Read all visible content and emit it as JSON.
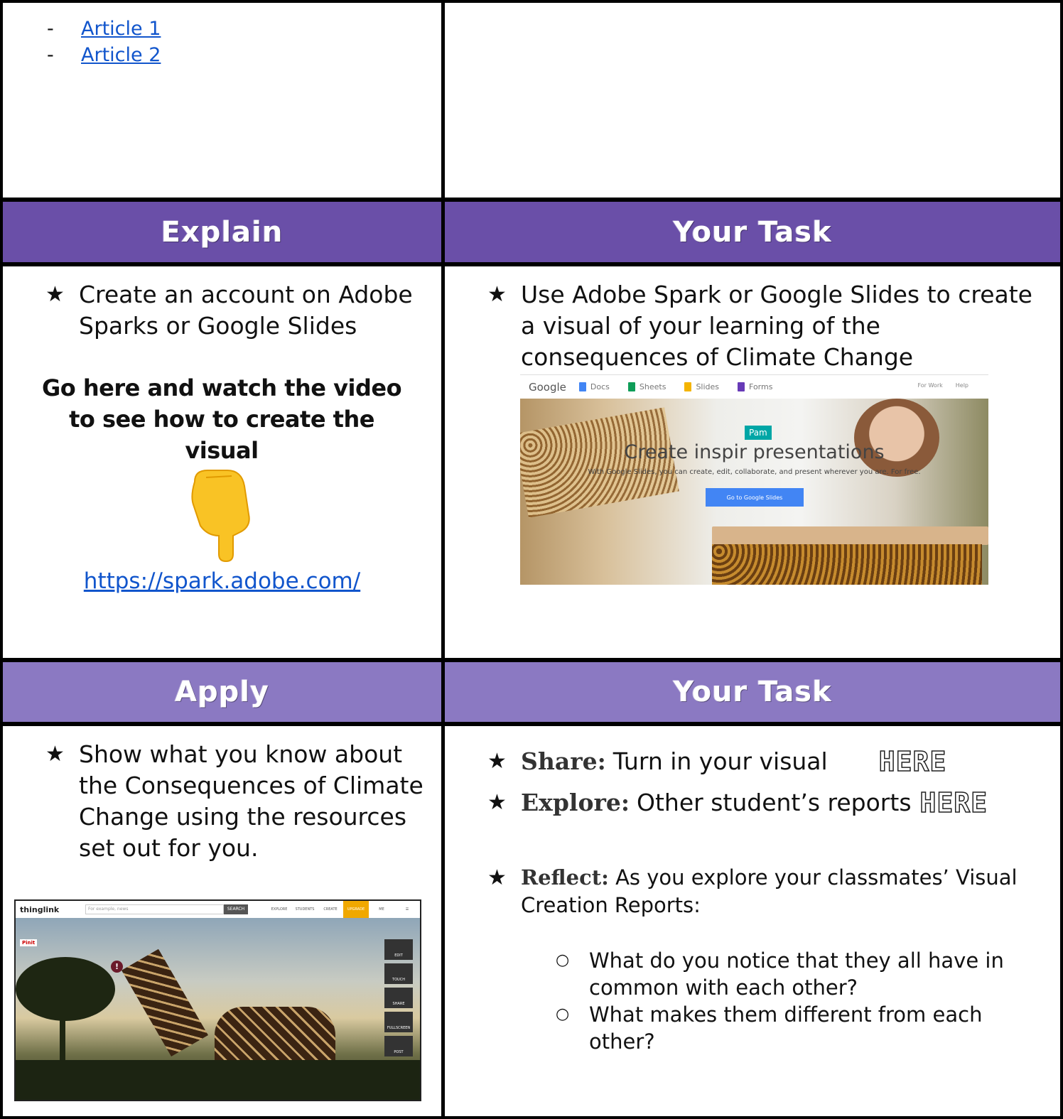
{
  "top_left": {
    "links": [
      {
        "bullet": "-",
        "text": "Article 1"
      },
      {
        "bullet": "-",
        "text": "Article 2"
      }
    ]
  },
  "explain_row": {
    "left_header": "Explain",
    "right_header": "Your Task",
    "header_color": "#6a4fa8",
    "left_bullet": "Create an account on Adobe Sparks or Google Slides",
    "left_instruction": "Go here and watch the video to see how to create the visual",
    "left_emoji": "pointing-down-hand",
    "left_link": "https://spark.adobe.com/",
    "right_bullet": "Use Adobe Spark or Google Slides to create a visual of your learning of the consequences of Climate Change",
    "slides_screenshot": {
      "logo": "Google",
      "tabs": [
        "Docs",
        "Sheets",
        "Slides",
        "Forms"
      ],
      "right_links": [
        "For Work",
        "Help"
      ],
      "title": "Create inspir presentations",
      "subtitle": "With Google Slides, you can create, edit, collaborate, and present wherever you are. For free.",
      "button": "Go to Google Slides",
      "cursor_label": "Pam"
    }
  },
  "apply_row": {
    "left_header": "Apply",
    "right_header": "Your Task",
    "header_color": "#8b79c2",
    "left_bullet": "Show what you know about the Consequences of Climate Change using the resources set out for you.",
    "thinglink_screenshot": {
      "logo": "thinglink",
      "search_placeholder": "For example, news",
      "search_button": "SEARCH",
      "nav": [
        "EXPLORE",
        "STUDENTS",
        "CREATE",
        "UPGRADE",
        "ME"
      ],
      "side_buttons": [
        "EDIT",
        "TOUCH",
        "SHARE",
        "FULLSCREEN",
        "POST"
      ],
      "pin_label": "Pinit"
    },
    "share_label": "Share:",
    "share_text": "Turn in your visual",
    "share_here": "HERE",
    "explore_label": "Explore:",
    "explore_text": "Other student’s reports",
    "explore_here": "HERE",
    "reflect_label": "Reflect:",
    "reflect_text": "As you explore your classmates’ Visual Creation Reports:",
    "questions": [
      "What do you notice that they all have in common with each other?",
      "What makes them different from each other?"
    ]
  }
}
